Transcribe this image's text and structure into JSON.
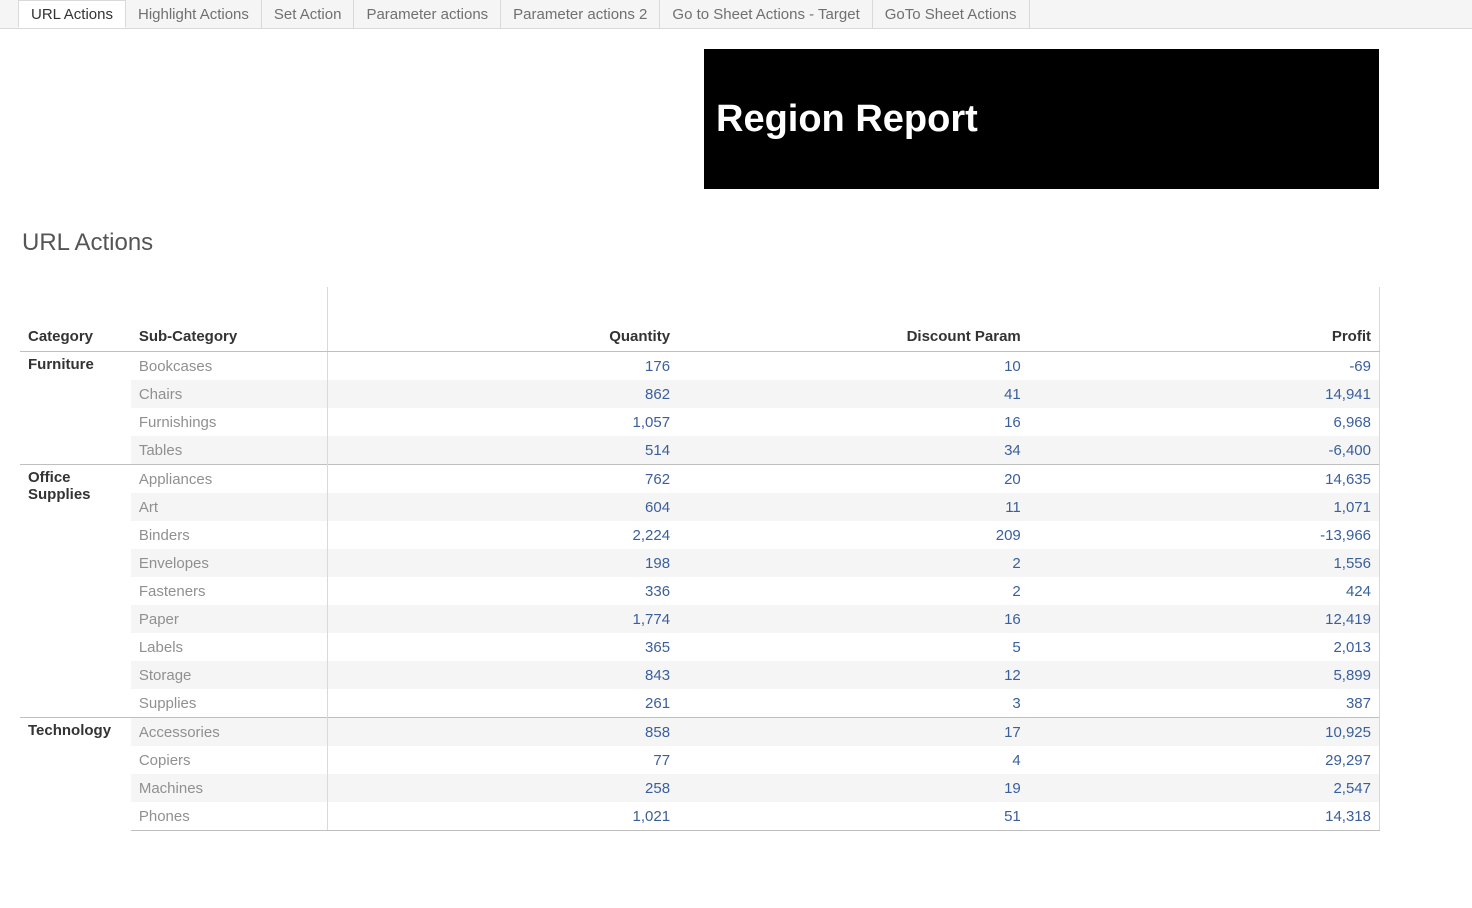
{
  "tabs": [
    {
      "label": "URL Actions",
      "active": true
    },
    {
      "label": "Highlight Actions",
      "active": false
    },
    {
      "label": "Set Action",
      "active": false
    },
    {
      "label": "Parameter actions",
      "active": false
    },
    {
      "label": "Parameter actions 2",
      "active": false
    },
    {
      "label": "Go to Sheet Actions - Target",
      "active": false
    },
    {
      "label": "GoTo Sheet Actions",
      "active": false
    }
  ],
  "banner": {
    "title": "Region Report"
  },
  "section": {
    "title": "URL Actions"
  },
  "table": {
    "headers": {
      "category": "Category",
      "sub_category": "Sub-Category",
      "quantity": "Quantity",
      "discount_param": "Discount Param",
      "profit": "Profit"
    },
    "groups": [
      {
        "category": "Furniture",
        "rows": [
          {
            "sub": "Bookcases",
            "quantity": "176",
            "discount": "10",
            "profit": "-69"
          },
          {
            "sub": "Chairs",
            "quantity": "862",
            "discount": "41",
            "profit": "14,941"
          },
          {
            "sub": "Furnishings",
            "quantity": "1,057",
            "discount": "16",
            "profit": "6,968"
          },
          {
            "sub": "Tables",
            "quantity": "514",
            "discount": "34",
            "profit": "-6,400"
          }
        ]
      },
      {
        "category": "Office Supplies",
        "rows": [
          {
            "sub": "Appliances",
            "quantity": "762",
            "discount": "20",
            "profit": "14,635"
          },
          {
            "sub": "Art",
            "quantity": "604",
            "discount": "11",
            "profit": "1,071"
          },
          {
            "sub": "Binders",
            "quantity": "2,224",
            "discount": "209",
            "profit": "-13,966"
          },
          {
            "sub": "Envelopes",
            "quantity": "198",
            "discount": "2",
            "profit": "1,556"
          },
          {
            "sub": "Fasteners",
            "quantity": "336",
            "discount": "2",
            "profit": "424"
          },
          {
            "sub": "Paper",
            "quantity": "1,774",
            "discount": "16",
            "profit": "12,419"
          },
          {
            "sub": "Labels",
            "quantity": "365",
            "discount": "5",
            "profit": "2,013"
          },
          {
            "sub": "Storage",
            "quantity": "843",
            "discount": "12",
            "profit": "5,899"
          },
          {
            "sub": "Supplies",
            "quantity": "261",
            "discount": "3",
            "profit": "387"
          }
        ]
      },
      {
        "category": "Technology",
        "rows": [
          {
            "sub": "Accessories",
            "quantity": "858",
            "discount": "17",
            "profit": "10,925"
          },
          {
            "sub": "Copiers",
            "quantity": "77",
            "discount": "4",
            "profit": "29,297"
          },
          {
            "sub": "Machines",
            "quantity": "258",
            "discount": "19",
            "profit": "2,547"
          },
          {
            "sub": "Phones",
            "quantity": "1,021",
            "discount": "51",
            "profit": "14,318"
          }
        ]
      }
    ]
  }
}
